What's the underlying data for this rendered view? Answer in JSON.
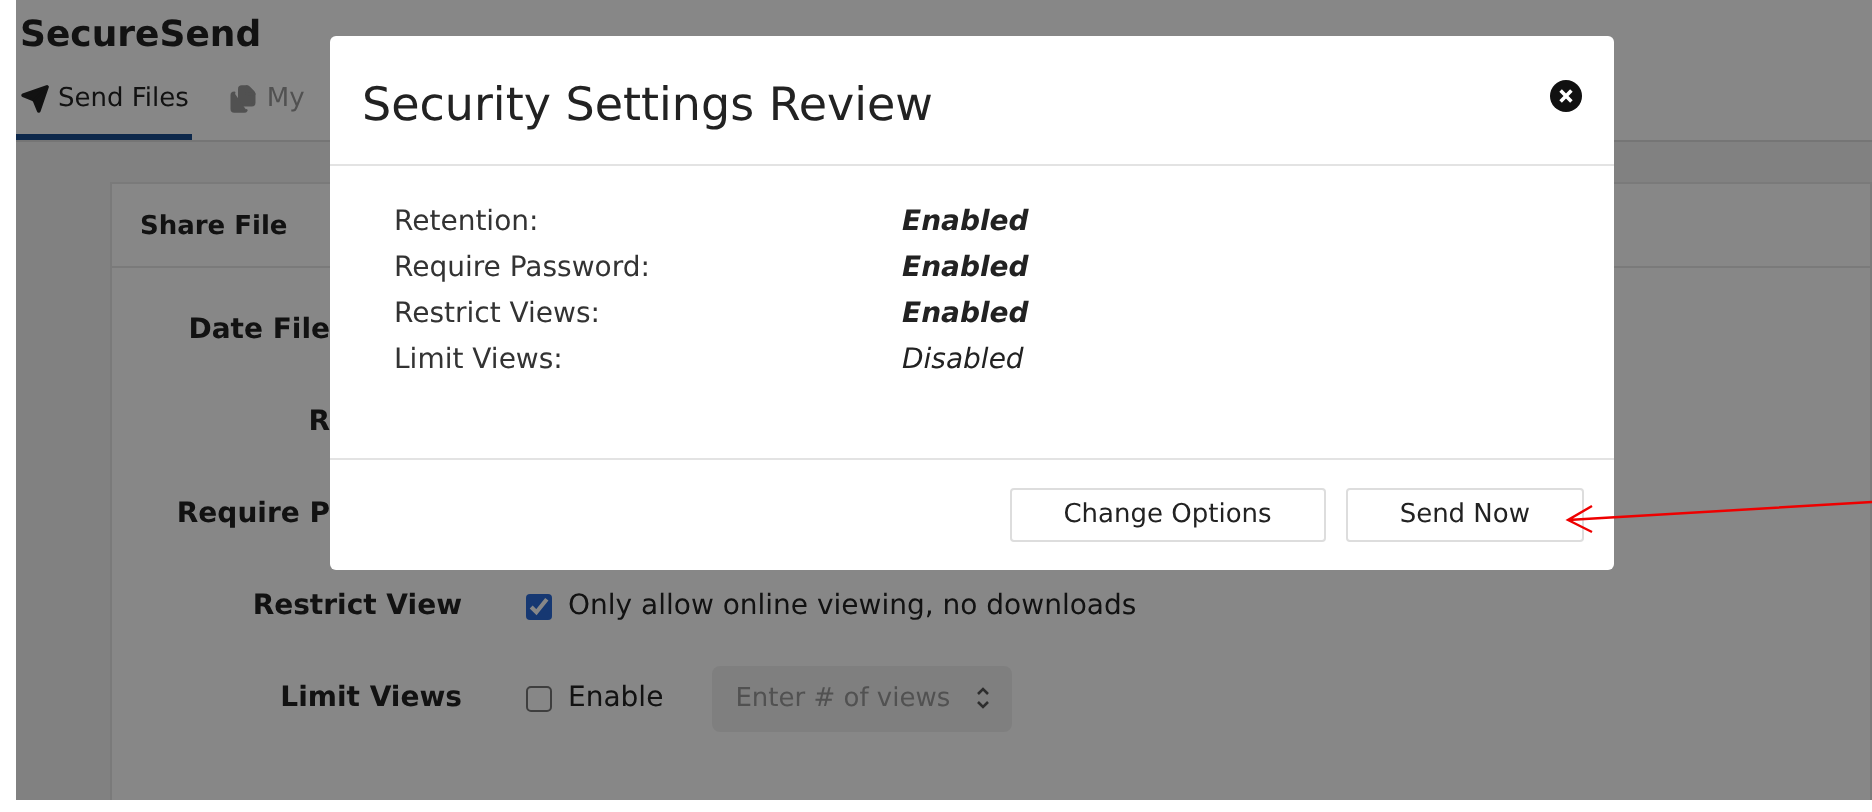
{
  "app": {
    "title": "SecureSend"
  },
  "tabs": [
    {
      "label": "Send Files",
      "selected": true
    },
    {
      "label": "My",
      "selected": false
    }
  ],
  "card": {
    "title": "Share File",
    "form": [
      {
        "label": "Date File",
        "kind": "covered"
      },
      {
        "label": "R",
        "kind": "covered"
      },
      {
        "label": "Require P",
        "kind": "covered"
      },
      {
        "label": "Restrict View",
        "kind": "checkbox",
        "checked": true,
        "text": "Only allow online viewing, no downloads"
      },
      {
        "label": "Limit Views",
        "kind": "checkbox_number",
        "checked": false,
        "text": "Enable",
        "placeholder": "Enter # of views"
      }
    ]
  },
  "dialog": {
    "title": "Security Settings Review",
    "settings": [
      {
        "name": "Retention:",
        "value": "Enabled",
        "enabled": true
      },
      {
        "name": "Require Password:",
        "value": "Enabled",
        "enabled": true
      },
      {
        "name": "Restrict Views:",
        "value": "Enabled",
        "enabled": true
      },
      {
        "name": "Limit Views:",
        "value": "Disabled",
        "enabled": false
      }
    ],
    "buttons": [
      "Change Options",
      "Send Now"
    ]
  }
}
